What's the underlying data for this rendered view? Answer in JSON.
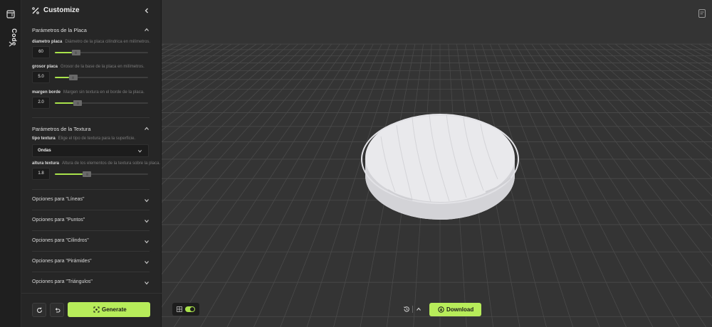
{
  "rail": {
    "label": "Code"
  },
  "panel": {
    "title": "Customize",
    "sections": {
      "placa": {
        "title": "Parámetros de la Placa",
        "params": [
          {
            "label": "diametro placa",
            "desc": "Diámetro de la placa cilíndrica en milímetros.",
            "value": "60",
            "fraction": 0.18
          },
          {
            "label": "grosor placa",
            "desc": "Grosor de la base de la placa en milímetros.",
            "value": "5.0",
            "fraction": 0.15
          },
          {
            "label": "margen borde",
            "desc": "Margen sin textura en el borde de la placa.",
            "value": "2.0",
            "fraction": 0.2
          }
        ]
      },
      "textura": {
        "title": "Parámetros de la Textura",
        "tipo": {
          "label": "tipo textura",
          "desc": "Elige el tipo de textura para la superficie.",
          "value": "Ondas"
        },
        "altura": {
          "label": "altura textura",
          "desc": "Altura de los elementos de la textura sobre la placa.",
          "value": "1.8",
          "fraction": 0.3
        }
      }
    },
    "options": [
      "Opciones para \"Líneas\"",
      "Opciones para \"Puntos\"",
      "Opciones para \"Cilindros\"",
      "Opciones para \"Pirámides\"",
      "Opciones para \"Triángulos\""
    ],
    "generate_label": "Generate"
  },
  "viewport": {
    "download_label": "Download",
    "grid_toggle_on": true
  },
  "colors": {
    "accent": "#b7ec5a",
    "panel_bg": "#262626",
    "viewport_bg": "#343434",
    "model": "#e9e9ec"
  }
}
